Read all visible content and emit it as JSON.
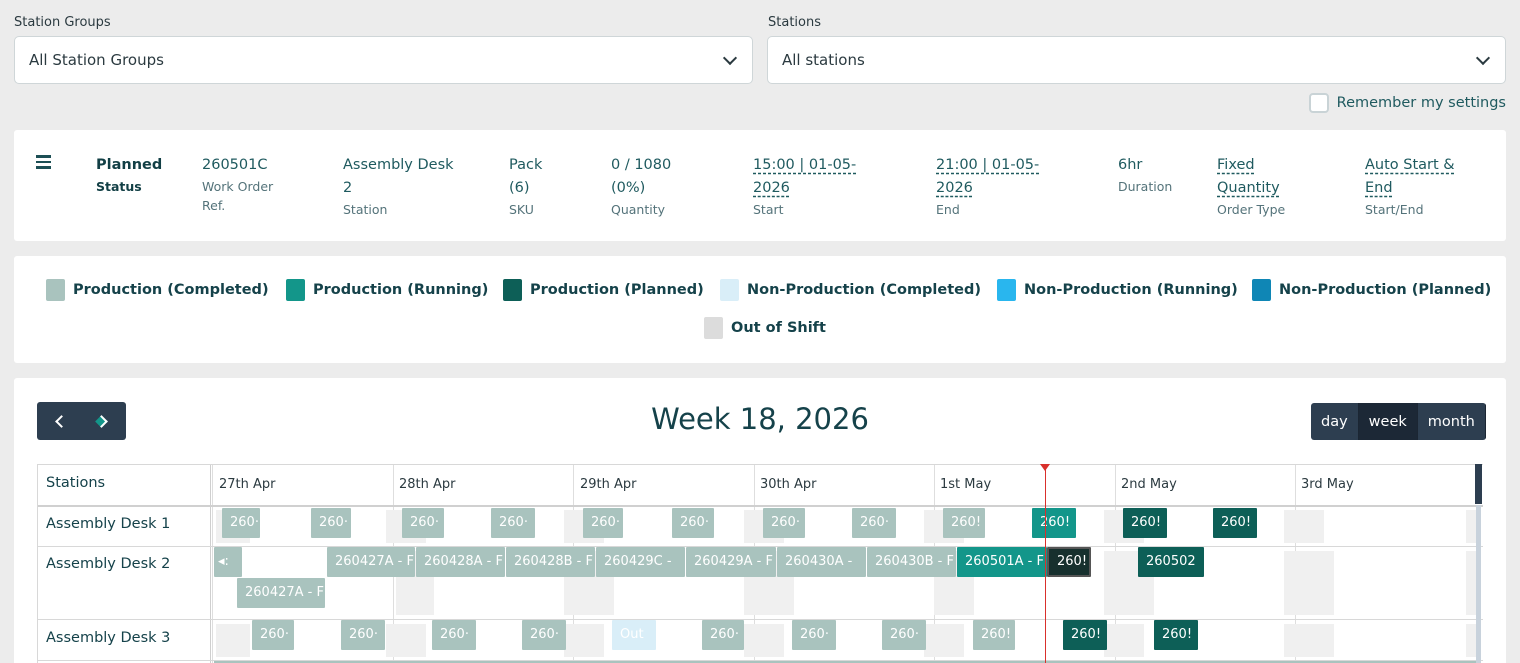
{
  "filters": {
    "station_groups_label": "Station Groups",
    "station_groups_value": "All Station Groups",
    "stations_label": "Stations",
    "stations_value": "All stations",
    "remember_label": "Remember my settings"
  },
  "summary": {
    "status_value": "Planned",
    "status_label": "Status",
    "work_order_value": "260501C",
    "work_order_label_1": "Work Order",
    "work_order_label_2": "Ref.",
    "station_value_1": "Assembly Desk",
    "station_value_2": "2",
    "station_label": "Station",
    "sku_value_1": "Pack",
    "sku_value_2": "(6)",
    "sku_label": "SKU",
    "quantity_value_1": "0 / 1080",
    "quantity_value_2": "(0%)",
    "quantity_label": "Quantity",
    "start_value_1": "15:00 | 01-05-",
    "start_value_2": "2026",
    "start_label": "Start",
    "end_value_1": "21:00 | 01-05-",
    "end_value_2": "2026",
    "end_label": "End",
    "duration_value": "6hr",
    "duration_label": "Duration",
    "order_type_value_1": "Fixed",
    "order_type_value_2": "Quantity",
    "order_type_label": "Order Type",
    "start_end_value_1": "Auto Start &",
    "start_end_value_2": "End",
    "start_end_label": "Start/End"
  },
  "legend": {
    "production_completed": "Production (Completed)",
    "production_running": "Production (Running)",
    "production_planned": "Production (Planned)",
    "nonproduction_completed": "Non-Production (Completed)",
    "nonproduction_running": "Non-Production (Running)",
    "nonproduction_planned": "Non-Production (Planned)",
    "out_of_shift": "Out of Shift"
  },
  "colors": {
    "production_completed": "#a9c3be",
    "production_running": "#13968a",
    "production_planned": "#0d5f57",
    "nonproduction_completed": "#d9eef8",
    "nonproduction_running": "#29b6ee",
    "nonproduction_planned": "#0f86b5",
    "out_of_shift": "#dcdcdc"
  },
  "calendar": {
    "title": "Week 18, 2026",
    "views": {
      "day": "day",
      "week": "week",
      "month": "month"
    },
    "stations_header": "Stations",
    "days": [
      "27th Apr",
      "28th Apr",
      "29th Apr",
      "30th Apr",
      "1st May",
      "2nd May",
      "3rd May"
    ],
    "rows": [
      "Assembly Desk 1",
      "Assembly Desk 2",
      "Assembly Desk 3"
    ],
    "blocks": {
      "d1": [
        "260·",
        "260·",
        "260·",
        "260·",
        "260·",
        "260·",
        "260·",
        "260·",
        "260!",
        "260!",
        "260!",
        "260!"
      ],
      "d2_top": [
        "◂:",
        "260427A - F",
        "260428A - F",
        "260428B - F",
        "260429C -",
        "260429A - F",
        "260430A -",
        "260430B - F",
        "260501A - F",
        "260!",
        "260502"
      ],
      "d2_bottom": [
        "260427A - F"
      ],
      "d3": [
        "260·",
        "260·",
        "260·",
        "260·",
        "Out",
        "260·",
        "260·",
        "260·",
        "260!",
        "260!",
        "260!"
      ]
    }
  }
}
